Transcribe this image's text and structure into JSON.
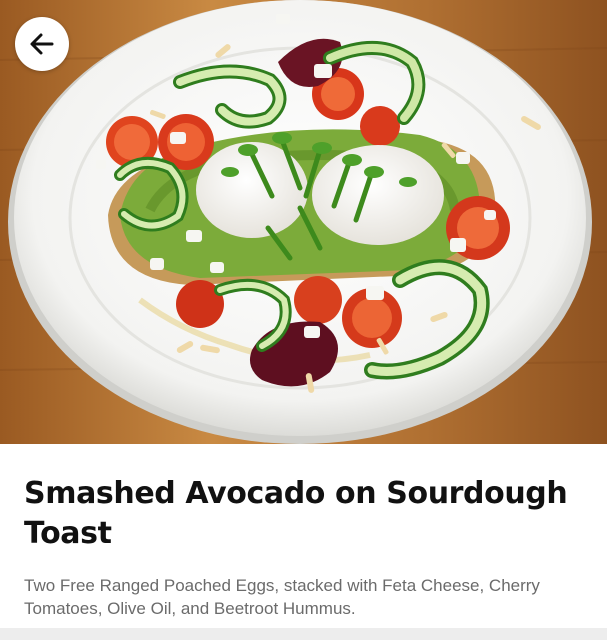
{
  "item": {
    "title": "Smashed Avocado on Sourdough Toast",
    "description": "Two Free Ranged Poached Eggs, stacked with Feta Cheese, Cherry Tomatoes, Olive Oil, and Beetroot Hummus."
  },
  "hero": {
    "back_icon": "arrow-left-icon",
    "image_subject": "food-photo"
  },
  "colors": {
    "title": "#111111",
    "description": "#6b6b6b",
    "background": "#ffffff",
    "divider": "#ededed"
  }
}
